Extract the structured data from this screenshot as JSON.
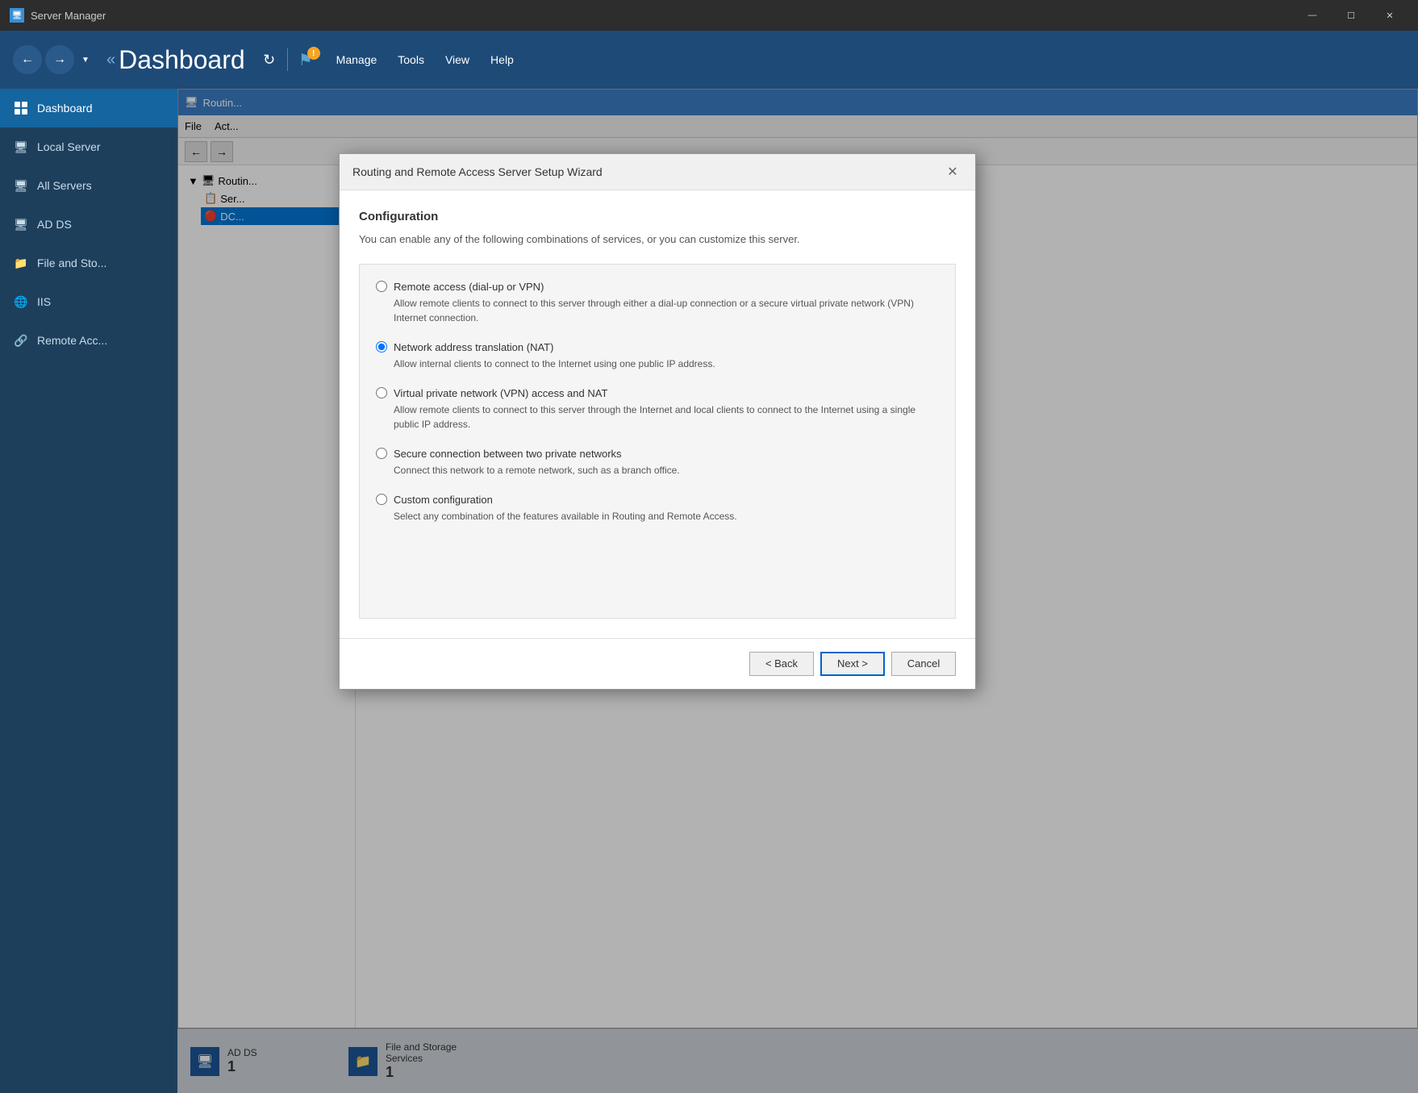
{
  "app": {
    "title": "Server Manager",
    "title_icon": "🖥"
  },
  "title_bar": {
    "minimize": "—",
    "restore": "☐",
    "close": "✕"
  },
  "header": {
    "title": "Dashboard",
    "title_prefix": "«",
    "nav_back": "←",
    "nav_forward": "→",
    "refresh_icon": "↻",
    "manage_label": "Manage",
    "tools_label": "Tools",
    "view_label": "View",
    "help_label": "Help"
  },
  "sidebar": {
    "items": [
      {
        "id": "dashboard",
        "label": "Dashboard",
        "active": true
      },
      {
        "id": "local-server",
        "label": "Local Server",
        "active": false
      },
      {
        "id": "all-servers",
        "label": "All Servers",
        "active": false
      },
      {
        "id": "ad-ds",
        "label": "AD DS",
        "active": false
      },
      {
        "id": "file-and-sto",
        "label": "File and Sto...",
        "active": false
      },
      {
        "id": "iis",
        "label": "IIS",
        "active": false
      },
      {
        "id": "remote-acc",
        "label": "Remote Acc...",
        "active": false
      }
    ]
  },
  "rras_window": {
    "title": "Routin...",
    "menu_file": "File",
    "menu_action": "Act...",
    "tree_label": "Routin...",
    "tree_item1": "Ser...",
    "tree_item2": "DC..."
  },
  "dialog": {
    "title": "Routing and Remote Access Server Setup Wizard",
    "close_icon": "✕",
    "section_title": "Configuration",
    "section_desc": "You can enable any of the following combinations of services, or you can customize this server.",
    "options": [
      {
        "id": "remote-access",
        "label": "Remote access (dial-up or VPN)",
        "desc": "Allow remote clients to connect to this server through either a dial-up connection or a secure virtual private network (VPN) Internet connection.",
        "checked": false
      },
      {
        "id": "nat",
        "label": "Network address translation (NAT)",
        "desc": "Allow internal clients to connect to the Internet using one public IP address.",
        "checked": true
      },
      {
        "id": "vpn-nat",
        "label": "Virtual private network (VPN) access and NAT",
        "desc": "Allow remote clients to connect to this server through the Internet and local clients to connect to the Internet using a single public IP address.",
        "checked": false
      },
      {
        "id": "secure-connection",
        "label": "Secure connection between two private networks",
        "desc": "Connect this network to a remote network, such as a branch office.",
        "checked": false
      },
      {
        "id": "custom",
        "label": "Custom configuration",
        "desc": "Select any combination of the features available in Routing and Remote Access.",
        "checked": false
      }
    ],
    "back_label": "< Back",
    "next_label": "Next >",
    "cancel_label": "Cancel"
  },
  "bottom_bar": {
    "tiles": [
      {
        "id": "ad-ds",
        "label": "AD DS",
        "count": "1"
      },
      {
        "id": "file-storage",
        "label": "File and Storage\nServices",
        "count": "1"
      }
    ]
  }
}
